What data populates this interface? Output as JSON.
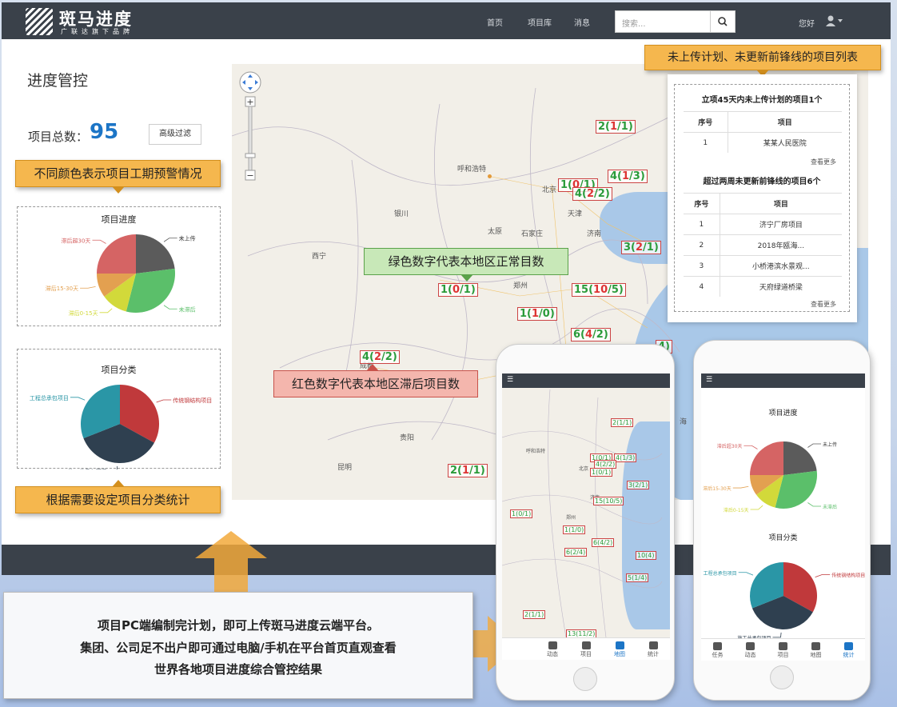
{
  "app": {
    "logo_name": "斑马进度",
    "logo_sub": "广联达旗下品牌"
  },
  "nav": {
    "links": [
      "首页",
      "项目库",
      "消息"
    ],
    "search_placeholder": "搜索...",
    "greeting": "您好"
  },
  "left": {
    "page_title": "进度管控",
    "total_label": "项目总数：",
    "total_value": "95",
    "filter_label": "高级过滤",
    "callout_top": "不同颜色表示项目工期预警情况",
    "callout_bottom": "根据需要设定项目分类统计"
  },
  "chart_data": [
    {
      "type": "pie",
      "title": "项目进度",
      "labels": [
        "未上传",
        "未滞后",
        "滞后0-15天",
        "滞后15-30天",
        "滞后超30天"
      ],
      "values": [
        23,
        31,
        11,
        10,
        25
      ],
      "colors": [
        "#5b5b5b",
        "#5bbf6a",
        "#d2d93a",
        "#e3a050",
        "#d56464"
      ]
    },
    {
      "type": "pie",
      "title": "项目分类",
      "labels": [
        "传统钢结构项目",
        "施工总承包项目",
        "工程总承包项目"
      ],
      "values": [
        33,
        36,
        31
      ],
      "colors": [
        "#c0393b",
        "#2f4050",
        "#2a96a6"
      ]
    }
  ],
  "map": {
    "city_labels": [
      "呼和浩特",
      "北京",
      "天津",
      "银川",
      "太原",
      "石家庄",
      "济南",
      "西宁",
      "郑州",
      "南京",
      "成都",
      "贵阳",
      "昆明",
      "海",
      "南"
    ],
    "markers": [
      {
        "total": "2",
        "delayed": "1",
        "ontime": "1"
      },
      {
        "total": "1",
        "delayed": "0",
        "ontime": "1"
      },
      {
        "total": "4",
        "delayed": "1",
        "ontime": "3"
      },
      {
        "total": "4",
        "delayed": "2",
        "ontime": "2"
      },
      {
        "total": "3",
        "delayed": "2",
        "ontime": "1"
      },
      {
        "total": "1",
        "delayed": "0",
        "ontime": "1"
      },
      {
        "total": "15",
        "delayed": "10",
        "ontime": "5"
      },
      {
        "total": "1",
        "delayed": "1",
        "ontime": "0"
      },
      {
        "total": "6",
        "delayed": "4",
        "ontime": "2"
      },
      {
        "total": "4",
        "delayed": "2",
        "ontime": "2"
      },
      {
        "total": "2",
        "delayed": "1",
        "ontime": "1"
      }
    ],
    "edge_marker": "4)",
    "green_note": "绿色数字代表本地区正常目数",
    "red_note": "红色数字代表本地区滞后项目数"
  },
  "right": {
    "callout": "未上传计划、未更新前锋线的项目列表",
    "section1_title": "立项45天内未上传计划的项目1个",
    "section2_title": "超过两周未更新前锋线的项目6个",
    "col_index": "序号",
    "col_project": "项目",
    "rows1": [
      {
        "idx": "1",
        "name": "某某人民医院"
      }
    ],
    "rows2": [
      {
        "idx": "1",
        "name": "济宁厂房项目"
      },
      {
        "idx": "2",
        "name": "2018年瓯海..."
      },
      {
        "idx": "3",
        "name": "小桥港滨水景观..."
      },
      {
        "idx": "4",
        "name": "天府绿道桥梁"
      }
    ],
    "more": "查看更多"
  },
  "bottom": {
    "line1": "项目PC端编制完计划，即可上传斑马进度云端平台。",
    "line2": "集团、公司足不出户即可通过电脑/手机在平台首页直观查看",
    "line3": "世界各地项目进度综合管控结果"
  },
  "phone_left": {
    "markers": [
      "2(1/1)",
      "4(1/3)",
      "1(0/1)",
      "4(2/2)",
      "1(0/1)",
      "3(2/1)",
      "15(10/5)",
      "1(0/1)",
      "1(1/0)",
      "6(4/2)",
      "10(4)",
      "6(2/4)",
      "5(1/4)",
      "2(1/1)",
      "13(11/2)"
    ],
    "map_cities": [
      "呼和浩特",
      "北京",
      "济南",
      "郑州"
    ],
    "tabs": [
      "动态",
      "项目",
      "地图",
      "统计"
    ],
    "active_tab": "地图"
  },
  "phone_right": {
    "chart1_title": "项目进度",
    "chart1_labels": [
      "未上传",
      "未滞后",
      "滞后0-15天",
      "滞后15-30天",
      "滞后超30天"
    ],
    "chart2_title": "项目分类",
    "chart2_labels": [
      "传统钢结构项目",
      "施工总承包项目",
      "工程总承包项目"
    ],
    "tabs": [
      "任务",
      "动态",
      "项目",
      "地图",
      "统计"
    ],
    "active_tab": "统计"
  }
}
